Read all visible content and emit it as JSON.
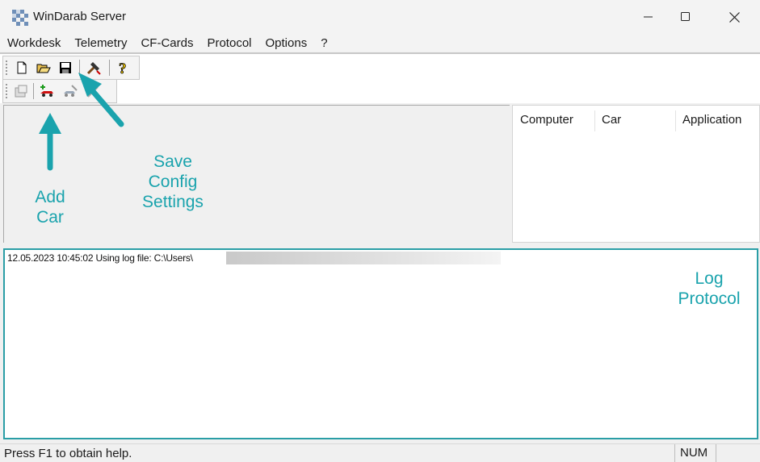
{
  "window": {
    "title": "WinDarab Server",
    "controls": [
      "minimize",
      "maximize",
      "close"
    ]
  },
  "menu": {
    "items": [
      "Workdesk",
      "Telemetry",
      "CF-Cards",
      "Protocol",
      "Options",
      "?"
    ]
  },
  "toolbar1": {
    "buttons": [
      "new-file-icon",
      "open-folder-icon",
      "save-icon",
      "tools-icon",
      "help-icon"
    ]
  },
  "toolbar2": {
    "buttons": [
      "properties-icon",
      "add-car-icon",
      "connect-car-icon",
      "disconnect-icon"
    ]
  },
  "list": {
    "columns": [
      "Computer",
      "Car",
      "Application"
    ]
  },
  "log": {
    "line": "12.05.2023 10:45:02 Using log file: C:\\Users\\"
  },
  "status": {
    "help_text": "Press F1 to obtain help.",
    "num": "NUM"
  },
  "annotations": {
    "add_car": "Add\nCar",
    "save_config": "Save\nConfig\nSettings",
    "log_protocol": "Log\nProtocol"
  },
  "colors": {
    "annotation": "#1aa3ad",
    "frame": "#2a9ea6"
  }
}
